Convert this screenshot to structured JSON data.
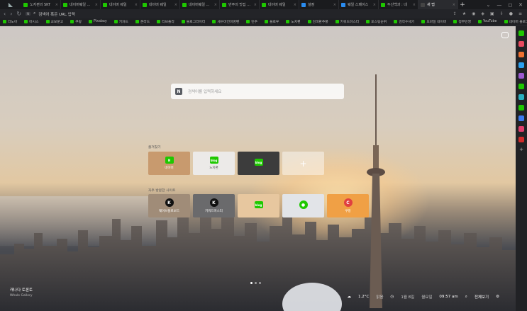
{
  "tabs": [
    {
      "label": "노지편의 SKT",
      "color": "#1ec800"
    },
    {
      "label": "네이버웨일 ...",
      "color": "#1ec800"
    },
    {
      "label": "네이버 웨일",
      "color": "#1ec800"
    },
    {
      "label": "네이버 웨일",
      "color": "#1ec800"
    },
    {
      "label": "네이버웨일 ...",
      "color": "#1ec800"
    },
    {
      "label": "만주의 맛집 ...",
      "color": "#1ec800"
    },
    {
      "label": "네이버 웨일",
      "color": "#1ec800"
    },
    {
      "label": "설정",
      "color": "#2a8cf0"
    },
    {
      "label": "웨일 스페이스",
      "color": "#2a8cf0"
    },
    {
      "label": "두산백과 : 네",
      "color": "#1ec800"
    },
    {
      "label": "새 탭",
      "color": "#444",
      "active": true
    }
  ],
  "address": {
    "placeholder": "검색어 혹은 URL 입력",
    "badge": "N"
  },
  "bookmarks": [
    "라노아",
    "마시스",
    "교보문고",
    "쿠팡",
    "Pixabay",
    "키자드",
    "온라드",
    "티브플라",
    "블로그라이터",
    "세수마전미명편",
    "민주",
    "블로우",
    "노지편",
    "검색환추풍",
    "키워드마스터",
    "포스팅순위",
    "검작수세기",
    "모바일 네이버",
    "정부민영",
    "YouTube",
    "네이버 블로그짐 온..."
  ],
  "search": {
    "placeholder": "검색어를 입력하세요",
    "logo": "N"
  },
  "favorites": {
    "title": "즐겨찾기",
    "items": [
      {
        "label": "네이버",
        "icon": "N",
        "bg": "#c89a6e",
        "icoColor": "#1ec800"
      },
      {
        "label": "노지편",
        "icon": "blog",
        "bg": "#eceae8",
        "icoColor": "#1ec800",
        "dark": true
      },
      {
        "label": "",
        "icon": "blog",
        "bg": "#3c3c3c",
        "icoColor": "#1ec800"
      }
    ]
  },
  "frequent": {
    "title": "자주 방문한 사이트",
    "items": [
      {
        "label": "웨이브플로보드",
        "icon": "K",
        "bg": "#a08c78",
        "icoColor": "#111"
      },
      {
        "label": "키워드마스터",
        "icon": "K",
        "bg": "#6a6a6c",
        "icoColor": "#111"
      },
      {
        "label": "",
        "icon": "blog",
        "bg": "#e7c79f",
        "icoColor": "#1ec800"
      },
      {
        "label": "",
        "icon": "talk",
        "bg": "#e2e4e8",
        "icoColor": "#1ec800"
      },
      {
        "label": "쿠팡",
        "icon": "C",
        "bg": "#f0a045",
        "icoColor": "#e04040"
      }
    ]
  },
  "location": {
    "name": "캐나다 토론토",
    "credit": "Whale Gallery"
  },
  "weather": {
    "temp": "1.2°C",
    "sky": "맑음",
    "day": "월요일",
    "date": "1월 8일",
    "time": "09:57 am",
    "search_label": "전체보기"
  },
  "page": {
    "current": 1,
    "total": 3
  },
  "sidebar_colors": [
    "#1ec800",
    "#e84a5f",
    "#f07030",
    "#2aa0f0",
    "#9b59d0",
    "#1ec800",
    "#2ab0c0",
    "#1ec800",
    "#3a7af0",
    "#e03c6c",
    "#d02a2a"
  ]
}
